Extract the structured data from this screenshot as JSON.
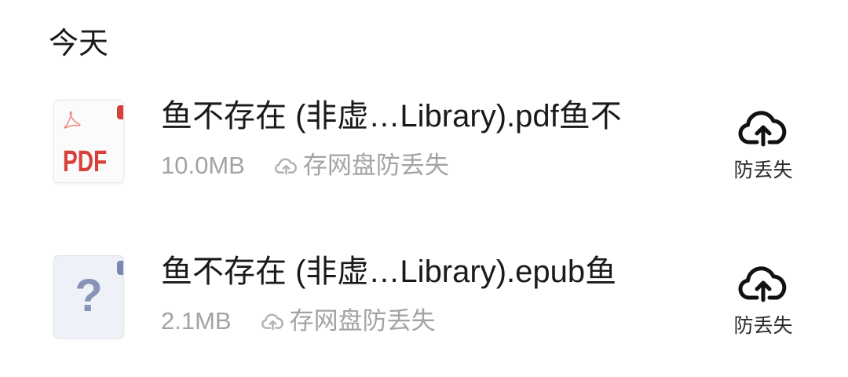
{
  "section": {
    "title": "今天"
  },
  "files": [
    {
      "name": "鱼不存在 (非虚…Library).pdf鱼不",
      "size": "10.0MB",
      "backup_hint": "存网盘防丢失",
      "backup_hint_icon": "cloud-upload-icon",
      "thumbnail": {
        "icon": "pdf-file-icon",
        "label": "PDF"
      },
      "action": {
        "label": "防丢失",
        "icon": "cloud-upload-icon"
      }
    },
    {
      "name": "鱼不存在 (非虚…Library).epub鱼",
      "size": "2.1MB",
      "backup_hint": "存网盘防丢失",
      "backup_hint_icon": "cloud-upload-icon",
      "thumbnail": {
        "icon": "unknown-file-icon",
        "label": "?"
      },
      "action": {
        "label": "防丢失",
        "icon": "cloud-upload-icon"
      }
    }
  ],
  "colors": {
    "background": "#ffffff",
    "text_primary": "#1a1a1a",
    "text_secondary": "#a3a3a3",
    "text_action": "#2a2a2a",
    "pdf_red": "#d8403a",
    "unknown_icon_bg": "#eef1f7",
    "unknown_icon_fg": "#8794b7",
    "unknown_icon_accent": "#7b89ae"
  }
}
